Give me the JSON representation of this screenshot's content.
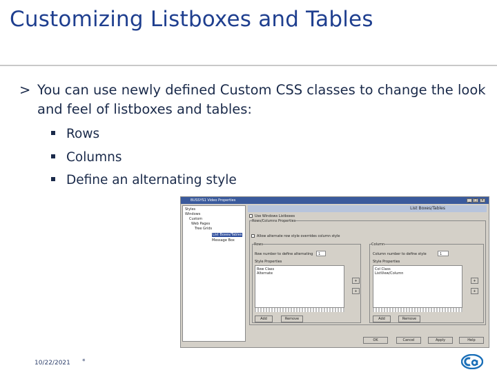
{
  "slide": {
    "title": "Customizing Listboxes and Tables",
    "bullet_marker": ">",
    "bullet_text": "You can use newly defined Custom CSS classes to change the look and feel of listboxes and tables:",
    "sub_items": [
      "Rows",
      "Columns",
      "Define an alternating style"
    ]
  },
  "screenshot": {
    "window_title": "BUSSYS1 Video Properties",
    "panel_header": "List Boxes/Tables",
    "tree_items": [
      "Styles",
      "Windows",
      "Custom",
      "Web Pages",
      "Tree Grids",
      "List Boxes/Tables",
      "Message Box"
    ],
    "checkbox1_label": "Use Windows Listboxes",
    "group_label": "Rows/Columns Properties",
    "checkbox2_label": "Allow alternate row style overrides column style",
    "rows_label": "Rows",
    "columns_label": "Column",
    "rows_field_label": "Row number to define alternating",
    "rows_field_value": "1",
    "columns_field_label": "Column number to define style",
    "columns_field_value": "1",
    "rows_list_label": "Style Properties",
    "rows_list_items": [
      "Row Class",
      "Alternate"
    ],
    "columns_list_label": "Style Properties",
    "columns_list_items": [
      "Col Class",
      "ListView/Column"
    ],
    "add_label": "Add",
    "remove_label": "Remove",
    "ok_label": "OK",
    "cancel_label": "Cancel",
    "apply_label": "Apply",
    "help_label": "Help"
  },
  "footer": {
    "date": "10/22/2021",
    "page": "*"
  },
  "colors": {
    "title": "#1f3f8f",
    "logo": "#1a6fb8"
  }
}
